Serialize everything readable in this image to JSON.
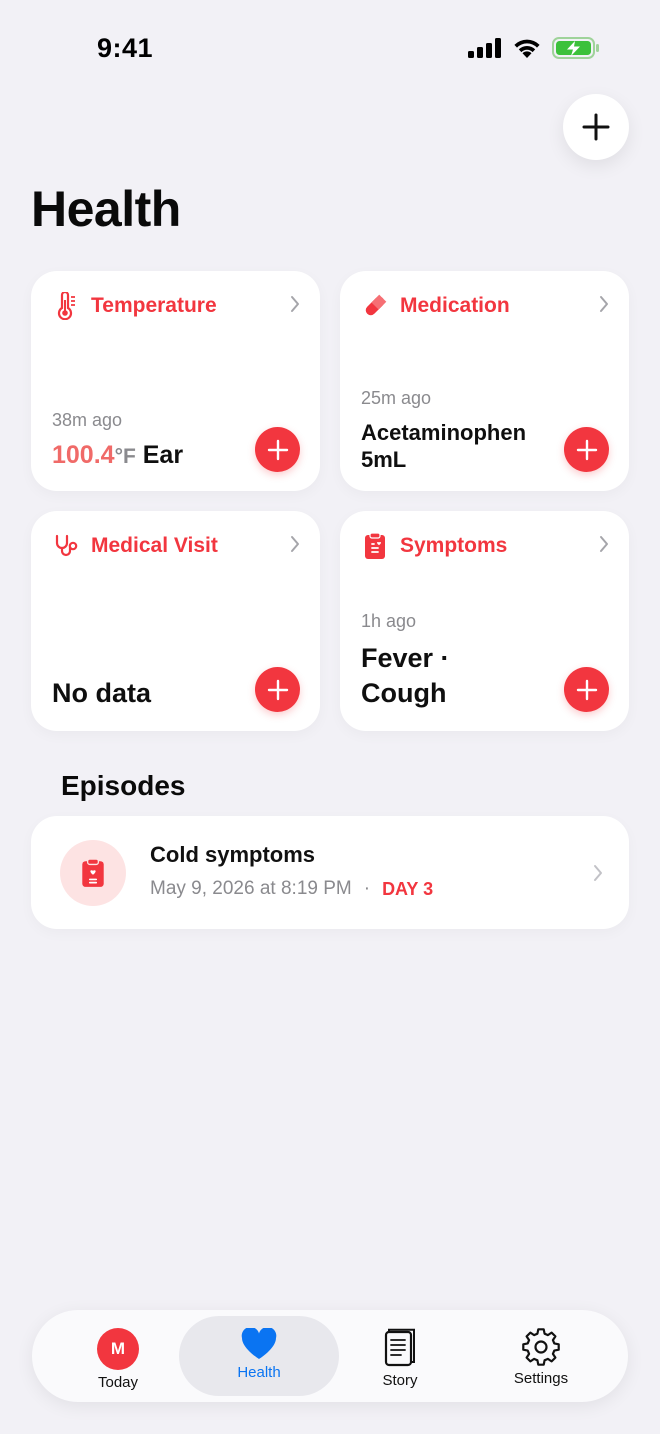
{
  "status_bar": {
    "time": "9:41"
  },
  "header": {
    "title": "Health"
  },
  "cards": {
    "temperature": {
      "title": "Temperature",
      "ago": "38m ago",
      "value": "100.4",
      "unit": "°F",
      "site": "Ear"
    },
    "medication": {
      "title": "Medication",
      "ago": "25m ago",
      "line1": "Acetaminophen",
      "line2": "5mL"
    },
    "medical_visit": {
      "title": "Medical Visit",
      "value": "No data"
    },
    "symptoms": {
      "title": "Symptoms",
      "ago": "1h ago",
      "line1": "Fever ·",
      "line2": "Cough"
    }
  },
  "episodes": {
    "title": "Episodes",
    "items": [
      {
        "name": "Cold symptoms",
        "date": "May 9, 2026 at 8:19 PM",
        "separator": "·",
        "day": "DAY 3"
      }
    ]
  },
  "tab_bar": {
    "avatar_initial": "M",
    "tabs": [
      {
        "label": "Today"
      },
      {
        "label": "Health"
      },
      {
        "label": "Story"
      },
      {
        "label": "Settings"
      }
    ],
    "active": "Health"
  },
  "colors": {
    "accent_red": "#f2363f",
    "active_tab_blue": "#0a74f2",
    "background": "#f2f1f6"
  },
  "icons": [
    "signal-icon",
    "wifi-icon",
    "battery-charging-icon",
    "plus-icon",
    "thermometer-icon",
    "pill-icon",
    "stethoscope-icon",
    "clipboard-icon",
    "chevron-right-icon",
    "heart-icon",
    "book-icon",
    "gear-icon"
  ]
}
